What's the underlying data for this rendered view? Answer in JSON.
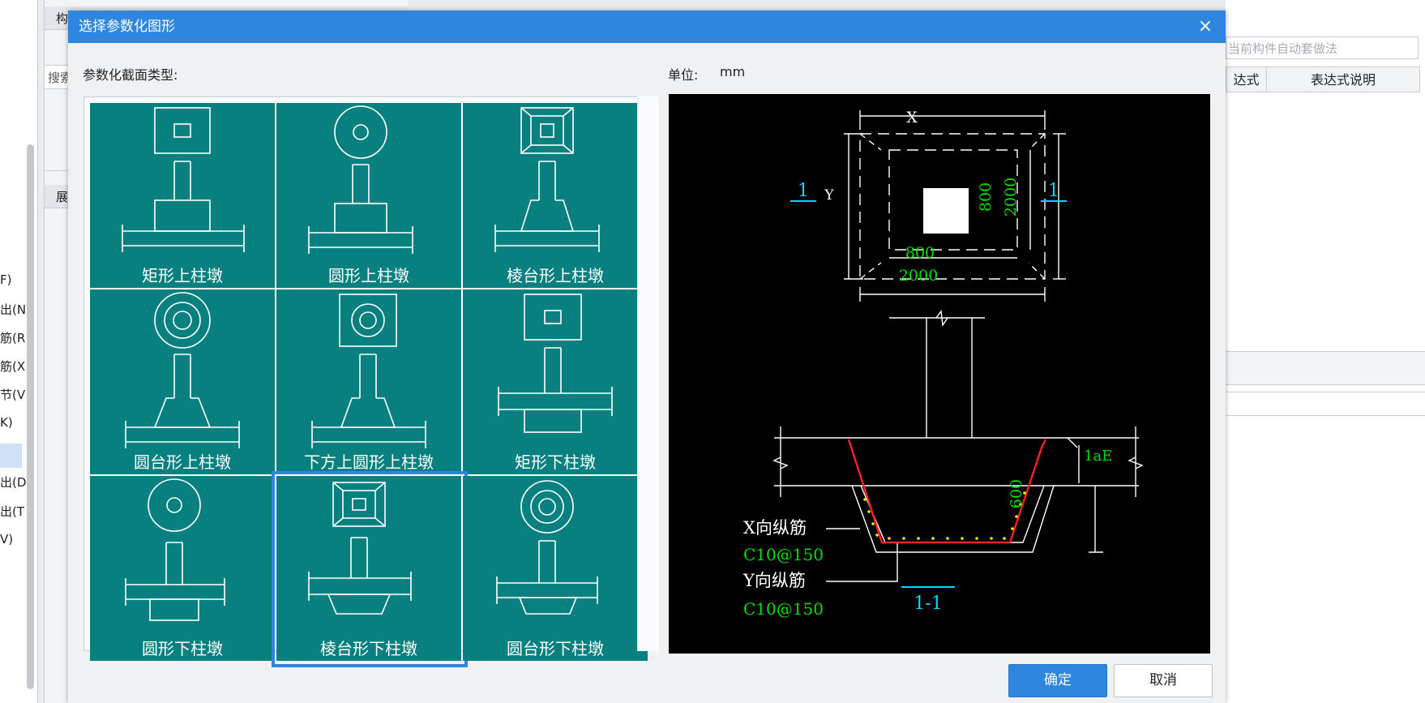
{
  "dialog": {
    "title": "选择参数化图形",
    "close_glyph": "×",
    "section_label": "参数化截面类型:",
    "unit_label": "单位:",
    "unit_value": "mm",
    "ok_label": "确定",
    "cancel_label": "取消"
  },
  "shapes": [
    {
      "name": "矩形上柱墩"
    },
    {
      "name": "圆形上柱墩"
    },
    {
      "name": "棱台形上柱墩"
    },
    {
      "name": "圆台形上柱墩"
    },
    {
      "name": "下方上圆形上柱墩"
    },
    {
      "name": "矩形下柱墩"
    },
    {
      "name": "圆形下柱墩"
    },
    {
      "name": "棱台形下柱墩",
      "selected": true
    },
    {
      "name": "圆台形下柱墩"
    }
  ],
  "preview": {
    "dim_x": "X",
    "dim_y": "Y",
    "dim_800_h": "800",
    "dim_2000_h": "2000",
    "dim_800_v": "800",
    "dim_2000_v": "2000",
    "section_mark_left": "1",
    "section_mark_right": "1",
    "dim_lae": "1aE",
    "dim_600": "600",
    "x_rebar_label": "X向纵筋",
    "x_rebar_spec": "C10@150",
    "y_rebar_label": "Y向纵筋",
    "y_rebar_spec": "C10@150",
    "section_title": "1-1"
  },
  "background": {
    "left_items": [
      "F)",
      "出(N",
      "筋(R",
      "筋(X",
      "节(V",
      "K)",
      "出(D",
      "出(T",
      "V)"
    ],
    "mid_items": [
      "构",
      "搜索",
      "展"
    ],
    "right_field": "当前构件自动套做法",
    "right_headers": [
      "达式",
      "表达式说明"
    ]
  },
  "colors": {
    "title_bar": "#2e86de",
    "tile": "#088080",
    "dim_green": "#00e000",
    "rebar_red": "#ff2020",
    "section_cyan": "#00d8ff"
  }
}
